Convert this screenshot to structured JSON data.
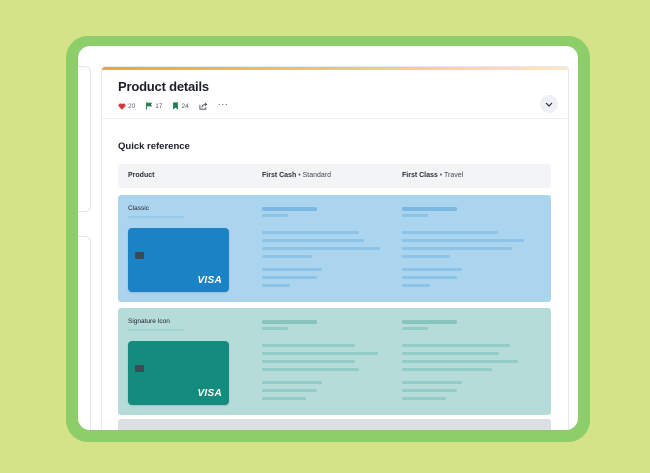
{
  "page": {
    "title": "Product details",
    "actions": [
      {
        "icon": "heart-icon",
        "count": "20",
        "color": "#d9363e"
      },
      {
        "icon": "flag-icon",
        "count": "17",
        "color": "#1e7f4e"
      },
      {
        "icon": "bookmark-icon",
        "count": "24",
        "color": "#1e7f4e"
      },
      {
        "icon": "share-icon"
      },
      {
        "icon": "more-options-icon",
        "label": "···"
      }
    ]
  },
  "quick_reference": {
    "title": "Quick reference",
    "columns": [
      {
        "label": "Product"
      },
      {
        "label": "First Cash",
        "sub": "Standard"
      },
      {
        "label": "First Class",
        "sub": "Travel"
      }
    ],
    "separator": "•",
    "rows": [
      {
        "product": "Classic",
        "card_color": "#1b82c5",
        "row_color": "#abd5ee",
        "placeholder_color": "#8cc3e6",
        "brand": "VISA"
      },
      {
        "product": "Signature Icon",
        "card_color": "#138c7e",
        "row_color": "#b5dcd9",
        "placeholder_color": "#93ccc6",
        "brand": "VISA"
      }
    ]
  },
  "colors": {
    "background": "#d4e388",
    "frame": "#8dcd6a",
    "accent_bar": "#f2a23c"
  }
}
